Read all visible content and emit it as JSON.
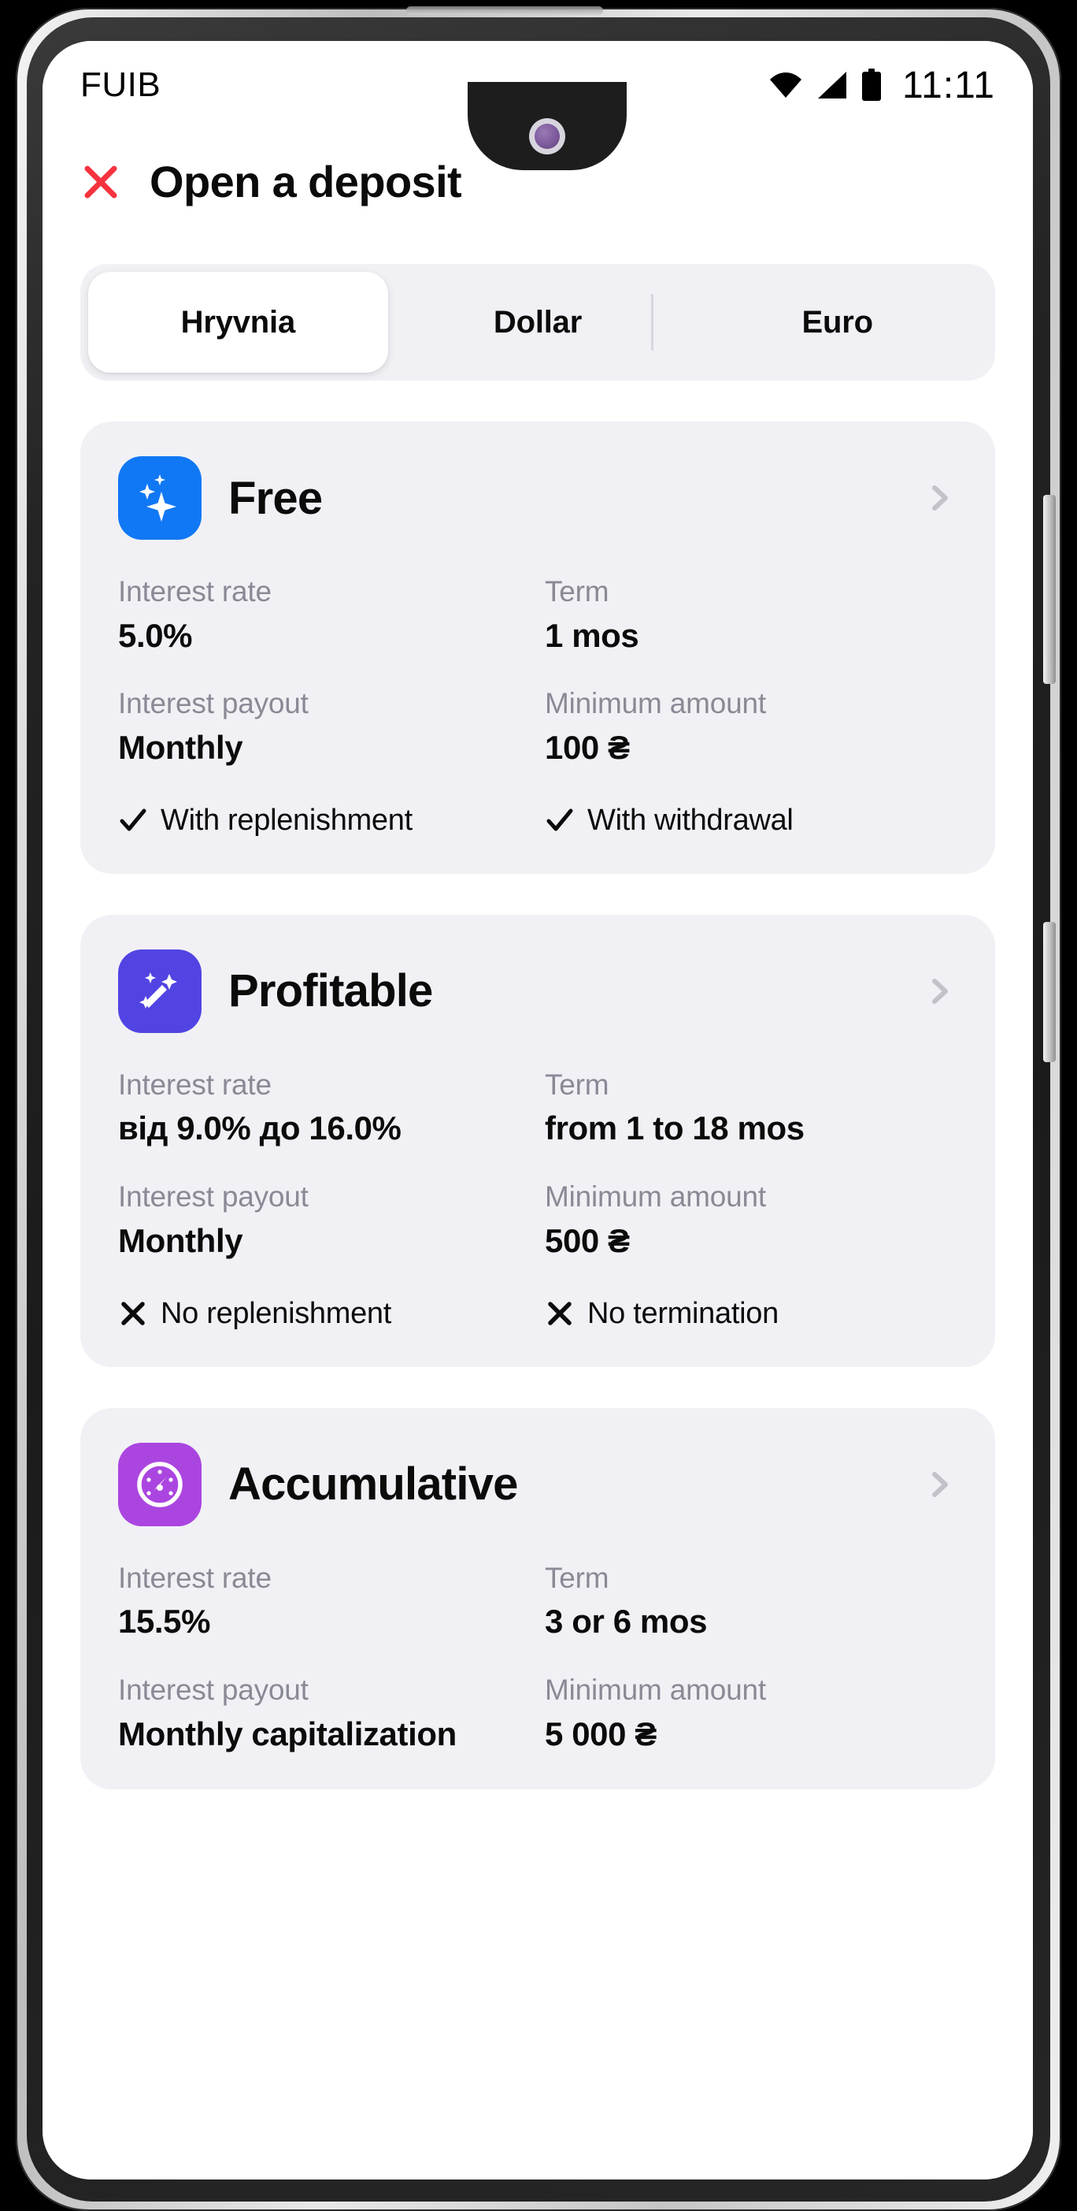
{
  "status_bar": {
    "carrier": "FUIB",
    "time": "11:11",
    "icons": [
      "wifi-icon",
      "cellular-signal-icon",
      "battery-icon"
    ]
  },
  "header": {
    "close_icon": "close-x-icon",
    "close_color": "#f5333f",
    "title": "Open a deposit"
  },
  "currency_tabs": {
    "selected": "Hryvnia",
    "items": [
      {
        "label": "Hryvnia",
        "active": true
      },
      {
        "label": "Dollar",
        "active": false
      },
      {
        "label": "Euro",
        "active": false
      }
    ]
  },
  "labels": {
    "interest_rate": "Interest rate",
    "term": "Term",
    "interest_payout": "Interest payout",
    "minimum_amount": "Minimum amount"
  },
  "deposits": [
    {
      "name": "Free",
      "icon": "sparkles-icon",
      "icon_bg": "#1178f5",
      "chevron": "chevron-right-icon",
      "interest_rate": "5.0%",
      "term": "1 mos",
      "interest_payout": "Monthly",
      "minimum_amount": "100 ₴",
      "features": [
        {
          "mark": "check-icon",
          "text": "With replenishment"
        },
        {
          "mark": "check-icon",
          "text": "With withdrawal"
        }
      ]
    },
    {
      "name": "Profitable",
      "icon": "magic-wand-icon",
      "icon_bg": "#5244e3",
      "chevron": "chevron-right-icon",
      "interest_rate": "від 9.0% до 16.0%",
      "term": "from 1 to 18 mos",
      "interest_payout": "Monthly",
      "minimum_amount": "500 ₴",
      "features": [
        {
          "mark": "cross-icon",
          "text": "No replenishment"
        },
        {
          "mark": "cross-icon",
          "text": "No termination"
        }
      ]
    },
    {
      "name": "Accumulative",
      "icon": "speedometer-icon",
      "icon_bg": "#ab45e0",
      "chevron": "chevron-right-icon",
      "interest_rate": "15.5%",
      "term": "3 or 6 mos",
      "interest_payout": "Monthly capitalization",
      "minimum_amount": "5 000 ₴",
      "features": []
    }
  ],
  "theme": {
    "card_bg": "#f1f1f5",
    "page_bg": "#ffffff",
    "label_gray": "#8a8a96",
    "text_black": "#0b0b0b",
    "chevron_gray": "#c2c2ca"
  }
}
